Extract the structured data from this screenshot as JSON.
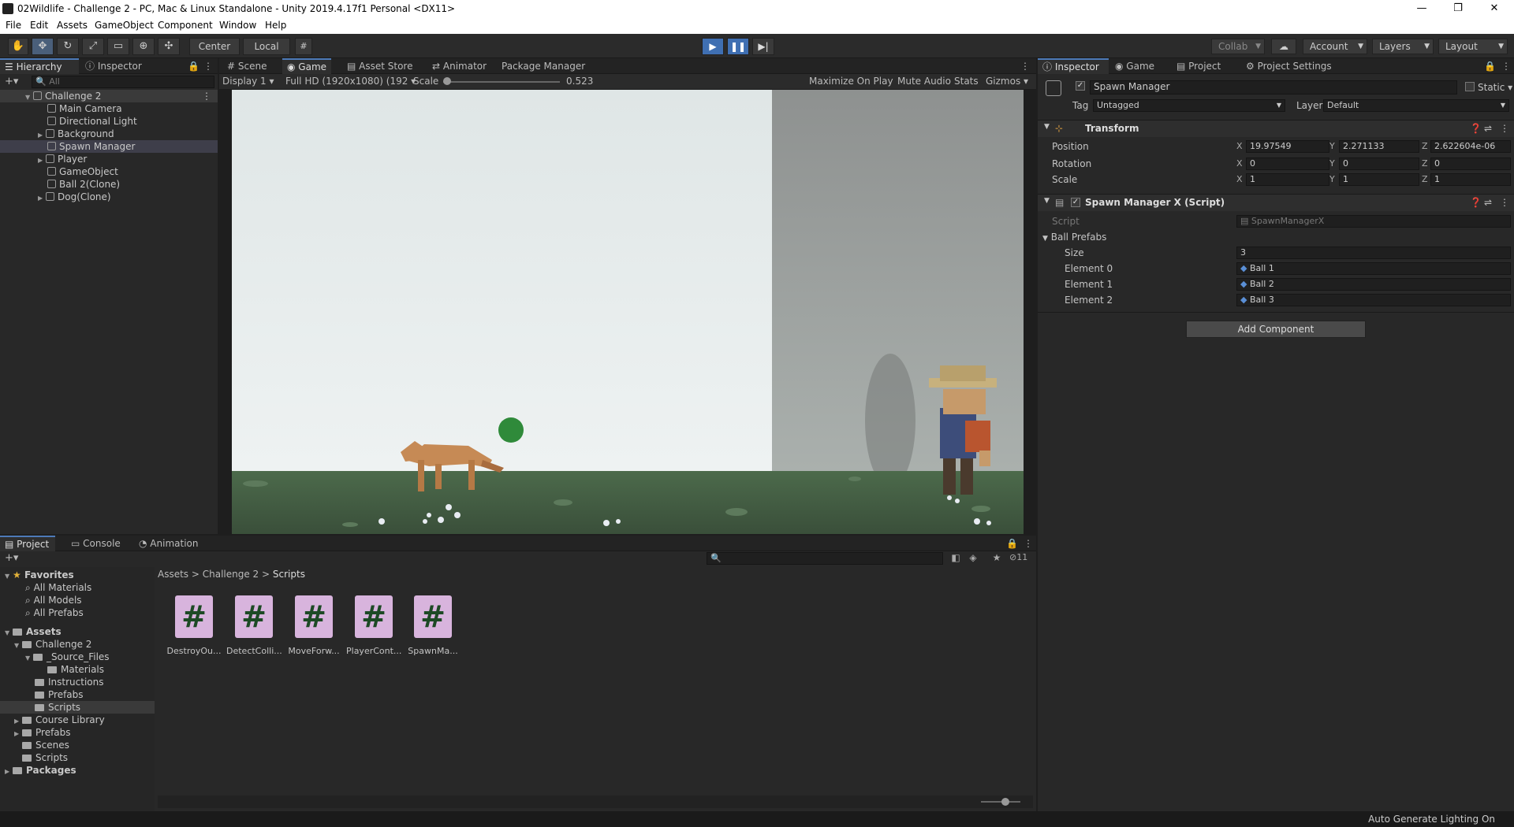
{
  "window": {
    "title": "02Wildlife - Challenge 2 - PC, Mac & Linux Standalone - Unity 2019.4.17f1 Personal <DX11>"
  },
  "menu": [
    "File",
    "Edit",
    "Assets",
    "GameObject",
    "Component",
    "Window",
    "Help"
  ],
  "toolbar": {
    "pivot_center": "Center",
    "pivot_local": "Local",
    "collab": "Collab",
    "account": "Account",
    "layers": "Layers",
    "layout": "Layout"
  },
  "left_tabs": {
    "hierarchy": "Hierarchy",
    "inspector": "Inspector"
  },
  "hierarchy": {
    "search_placeholder": "All",
    "scene": "Challenge 2",
    "items": [
      "Main Camera",
      "Directional Light",
      "Background",
      "Spawn Manager",
      "Player",
      "GameObject",
      "Ball 2(Clone)",
      "Dog(Clone)"
    ]
  },
  "center_tabs": [
    "Scene",
    "Game",
    "Asset Store",
    "Animator",
    "Package Manager"
  ],
  "game_bar": {
    "display": "Display 1",
    "resolution": "Full HD (1920x1080) (192",
    "scale_label": "Scale",
    "scale_value": "0.523",
    "maximize": "Maximize On Play",
    "mute": "Mute Audio",
    "stats": "Stats",
    "gizmos": "Gizmos"
  },
  "right_tabs": [
    "Inspector",
    "Game",
    "Project",
    "Project Settings"
  ],
  "inspector": {
    "object_name": "Spawn Manager",
    "static_label": "Static",
    "tag_label": "Tag",
    "tag_value": "Untagged",
    "layer_label": "Layer",
    "layer_value": "Default",
    "transform": {
      "title": "Transform",
      "position_label": "Position",
      "rotation_label": "Rotation",
      "scale_label": "Scale",
      "position": {
        "x": "19.97549",
        "y": "2.271133",
        "z": "2.622604e-06"
      },
      "rotation": {
        "x": "0",
        "y": "0",
        "z": "0"
      },
      "scale": {
        "x": "1",
        "y": "1",
        "z": "1"
      }
    },
    "script_component": {
      "title": "Spawn Manager X (Script)",
      "script_label": "Script",
      "script_value": "SpawnManagerX",
      "array_label": "Ball Prefabs",
      "size_label": "Size",
      "size_value": "3",
      "elements": [
        {
          "label": "Element 0",
          "value": "Ball 1"
        },
        {
          "label": "Element 1",
          "value": "Ball 2"
        },
        {
          "label": "Element 2",
          "value": "Ball 3"
        }
      ]
    },
    "add_component": "Add Component"
  },
  "bottom_tabs": [
    "Project",
    "Console",
    "Animation"
  ],
  "project": {
    "badge_count": "11",
    "favorites_label": "Favorites",
    "favorites": [
      "All Materials",
      "All Models",
      "All Prefabs"
    ],
    "assets_label": "Assets",
    "tree": {
      "challenge": "Challenge 2",
      "source_files": "_Source_Files",
      "materials": "Materials",
      "instructions": "Instructions",
      "prefabs": "Prefabs",
      "scripts": "Scripts",
      "course_library": "Course Library",
      "prefabs2": "Prefabs",
      "scenes": "Scenes",
      "scripts2": "Scripts",
      "packages": "Packages"
    },
    "breadcrumb": [
      "Assets",
      "Challenge 2",
      "Scripts"
    ],
    "scripts": [
      "DestroyOu...",
      "DetectColli...",
      "MoveForw...",
      "PlayerCont...",
      "SpawnMa..."
    ]
  },
  "status": {
    "lighting": "Auto Generate Lighting On"
  },
  "colors": {
    "accent": "#3f6fb2",
    "editor_bg": "#282828",
    "sky": "#e4eaea",
    "ground": "#3f5a3e"
  },
  "icons": [
    "hand-icon",
    "move-icon",
    "rotate-icon",
    "scale-icon",
    "rect-icon",
    "transform-icon",
    "custom-tool-icon",
    "play-icon",
    "pause-icon",
    "step-icon",
    "cloud-icon",
    "script-icon",
    "gear-icon",
    "lock-icon",
    "help-icon",
    "search-icon",
    "star-icon",
    "folder-icon"
  ]
}
